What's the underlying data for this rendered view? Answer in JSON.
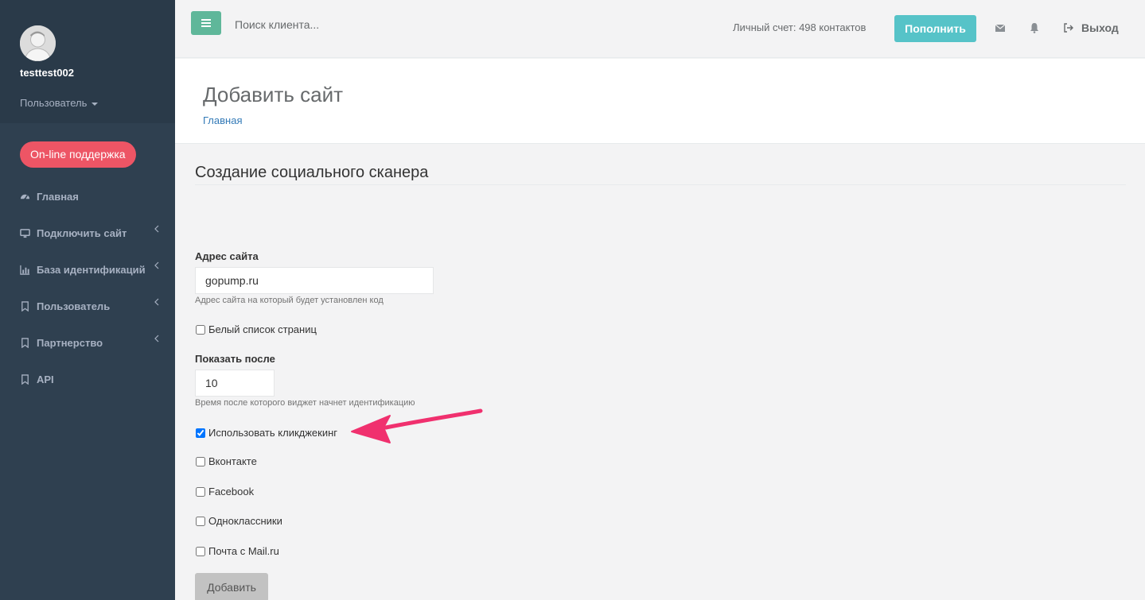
{
  "sidebar": {
    "username": "testtest002",
    "role": "Пользователь",
    "support_label": "On-line поддержка",
    "items": [
      {
        "label": "Главная",
        "icon": "dashboard-icon"
      },
      {
        "label": "Подключить сайт",
        "icon": "desktop-icon"
      },
      {
        "label": "База идентификаций",
        "icon": "bar-chart-icon"
      },
      {
        "label": "Пользователь",
        "icon": "bookmark-icon"
      },
      {
        "label": "Партнерство",
        "icon": "bookmark-icon"
      },
      {
        "label": "API",
        "icon": "bookmark-icon"
      }
    ]
  },
  "topbar": {
    "search_placeholder": "Поиск клиента...",
    "account": "Личный счет: 498 контактов",
    "topup_label": "Пополнить",
    "logout_label": "Выход"
  },
  "heading": {
    "title": "Добавить сайт",
    "breadcrumb": "Главная"
  },
  "form": {
    "section_title": "Создание социального сканера",
    "site_label": "Адрес сайта",
    "site_value": "gopump.ru",
    "site_help": "Адрес сайта на который будет установлен код",
    "whitelist_label": "Белый список страниц",
    "show_after_label": "Показать после",
    "show_after_value": "10",
    "show_after_help": "Время после которого виджет начнет идентификацию",
    "clickjacking_label": "Использовать кликджекинг",
    "vk_label": "Вконтакте",
    "facebook_label": "Facebook",
    "ok_label": "Одноклассники",
    "mailru_label": "Почта с Mail.ru",
    "submit_label": "Добавить"
  },
  "colors": {
    "sidebar": "#2f4050",
    "support": "#ed5565",
    "topup": "#56c3c8",
    "menu_button": "#5fb79a",
    "annotation_arrow": "#f0306e"
  }
}
